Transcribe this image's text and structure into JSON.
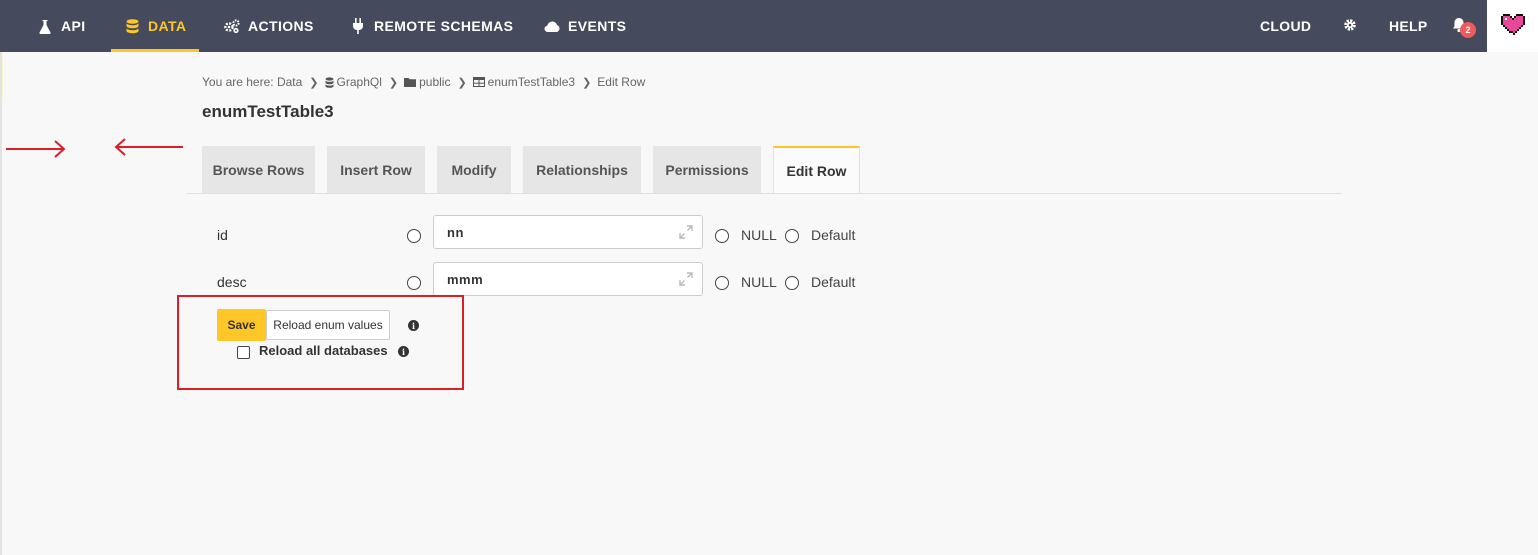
{
  "nav": {
    "api": "API",
    "data": "DATA",
    "actions": "ACTIONS",
    "remote_schemas": "REMOTE SCHEMAS",
    "events": "EVENTS",
    "cloud": "CLOUD",
    "help": "HELP",
    "notification_count": "2",
    "accent_color": "#ffc628"
  },
  "breadcrumb": {
    "prefix": "You are here: Data",
    "items": [
      "GraphQl",
      "public",
      "enumTestTable3",
      "Edit Row"
    ]
  },
  "page": {
    "title": "enumTestTable3"
  },
  "tabs": [
    "Browse Rows",
    "Insert Row",
    "Modify",
    "Relationships",
    "Permissions",
    "Edit Row"
  ],
  "active_tab": "Edit Row",
  "form": {
    "rows": [
      {
        "label": "id",
        "value": "nn",
        "null_label": "NULL",
        "default_label": "Default"
      },
      {
        "label": "desc",
        "value": "mmm",
        "null_label": "NULL",
        "default_label": "Default"
      }
    ],
    "save_label": "Save",
    "reload_enum_label": "Reload enum values",
    "reload_all_label": "Reload all databases"
  },
  "annotation_color": "#dc1f26"
}
